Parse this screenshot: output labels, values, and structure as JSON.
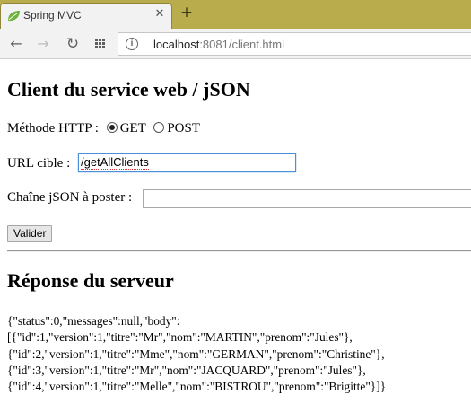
{
  "browser": {
    "tab_title": "Spring MVC",
    "url_host": "localhost",
    "url_rest": ":8081/client.html",
    "icons": [
      "spring-leaf-icon",
      "close-icon",
      "new-tab-icon",
      "back-arrow-icon",
      "forward-arrow-icon",
      "reload-icon",
      "apps-grid-icon",
      "info-icon"
    ]
  },
  "page": {
    "title": "Client du service web / jSON",
    "method_label": "Méthode HTTP :",
    "method_options": [
      "GET",
      "POST"
    ],
    "method_selected": "GET",
    "url_label": "URL cible :",
    "url_value": "/getAllClients",
    "json_label": "Chaîne jSON à poster :",
    "json_value": "",
    "submit_label": "Valider",
    "response_title": "Réponse du serveur",
    "response_lines": [
      "{\"status\":0,\"messages\":null,\"body\":",
      "[{\"id\":1,\"version\":1,\"titre\":\"Mr\",\"nom\":\"MARTIN\",\"prenom\":\"Jules\"},",
      "{\"id\":2,\"version\":1,\"titre\":\"Mme\",\"nom\":\"GERMAN\",\"prenom\":\"Christine\"},",
      "{\"id\":3,\"version\":1,\"titre\":\"Mr\",\"nom\":\"JACQUARD\",\"prenom\":\"Jules\"},",
      "{\"id\":4,\"version\":1,\"titre\":\"Melle\",\"nom\":\"BISTROU\",\"prenom\":\"Brigitte\"}]}"
    ]
  },
  "colors": {
    "tabstrip": "#b8ac4c",
    "spring_green": "#6db33f",
    "focus_border": "#4a90d9"
  }
}
